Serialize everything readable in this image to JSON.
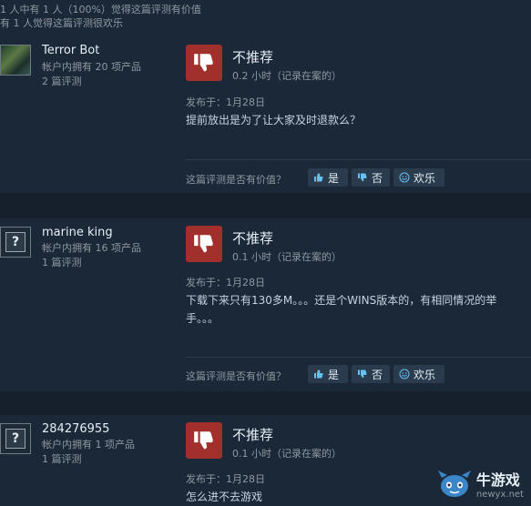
{
  "header": {
    "line1": "1 人中有 1 人（100%）觉得这篇评测有价值",
    "line2": "有 1 人觉得这篇评测很欢乐"
  },
  "reviews": [
    {
      "author": "Terror Bot",
      "products": "帐户内拥有 20 项产品",
      "review_count": "2 篇评测",
      "verdict": "不推荐",
      "hours": "0.2 小时（记录在案的）",
      "posted": "发布于：1月28日",
      "text_lines": [
        "提前放出是为了让大家及时退款么？"
      ],
      "helpful_question": "这篇评测是否有价值？",
      "buttons": {
        "yes": "是",
        "no": "否",
        "funny": "欢乐"
      }
    },
    {
      "author": "marine king",
      "products": "帐户内拥有 16 项产品",
      "review_count": "1 篇评测",
      "verdict": "不推荐",
      "hours": "0.1 小时（记录在案的）",
      "posted": "发布于：1月28日",
      "text_lines": [
        "下载下来只有130多M。。。还是个WINS版本的，有相同情况的举",
        "手。。。"
      ],
      "helpful_question": "这篇评测是否有价值？",
      "buttons": {
        "yes": "是",
        "no": "否",
        "funny": "欢乐"
      }
    },
    {
      "author": "284276955",
      "products": "帐户内拥有 1 项产品",
      "review_count": "1 篇评测",
      "verdict": "不推荐",
      "hours": "0.1 小时（记录在案的）",
      "posted": "发布于：1月28日",
      "text_lines": [
        "怎么进不去游戏"
      ]
    }
  ],
  "avatar_placeholder": "?",
  "watermark": {
    "name": "牛游戏",
    "url": "newyx.net"
  },
  "colors": {
    "background": "#1b2838",
    "thumb_down": "#a1302c",
    "button": "#2a3b4d"
  }
}
